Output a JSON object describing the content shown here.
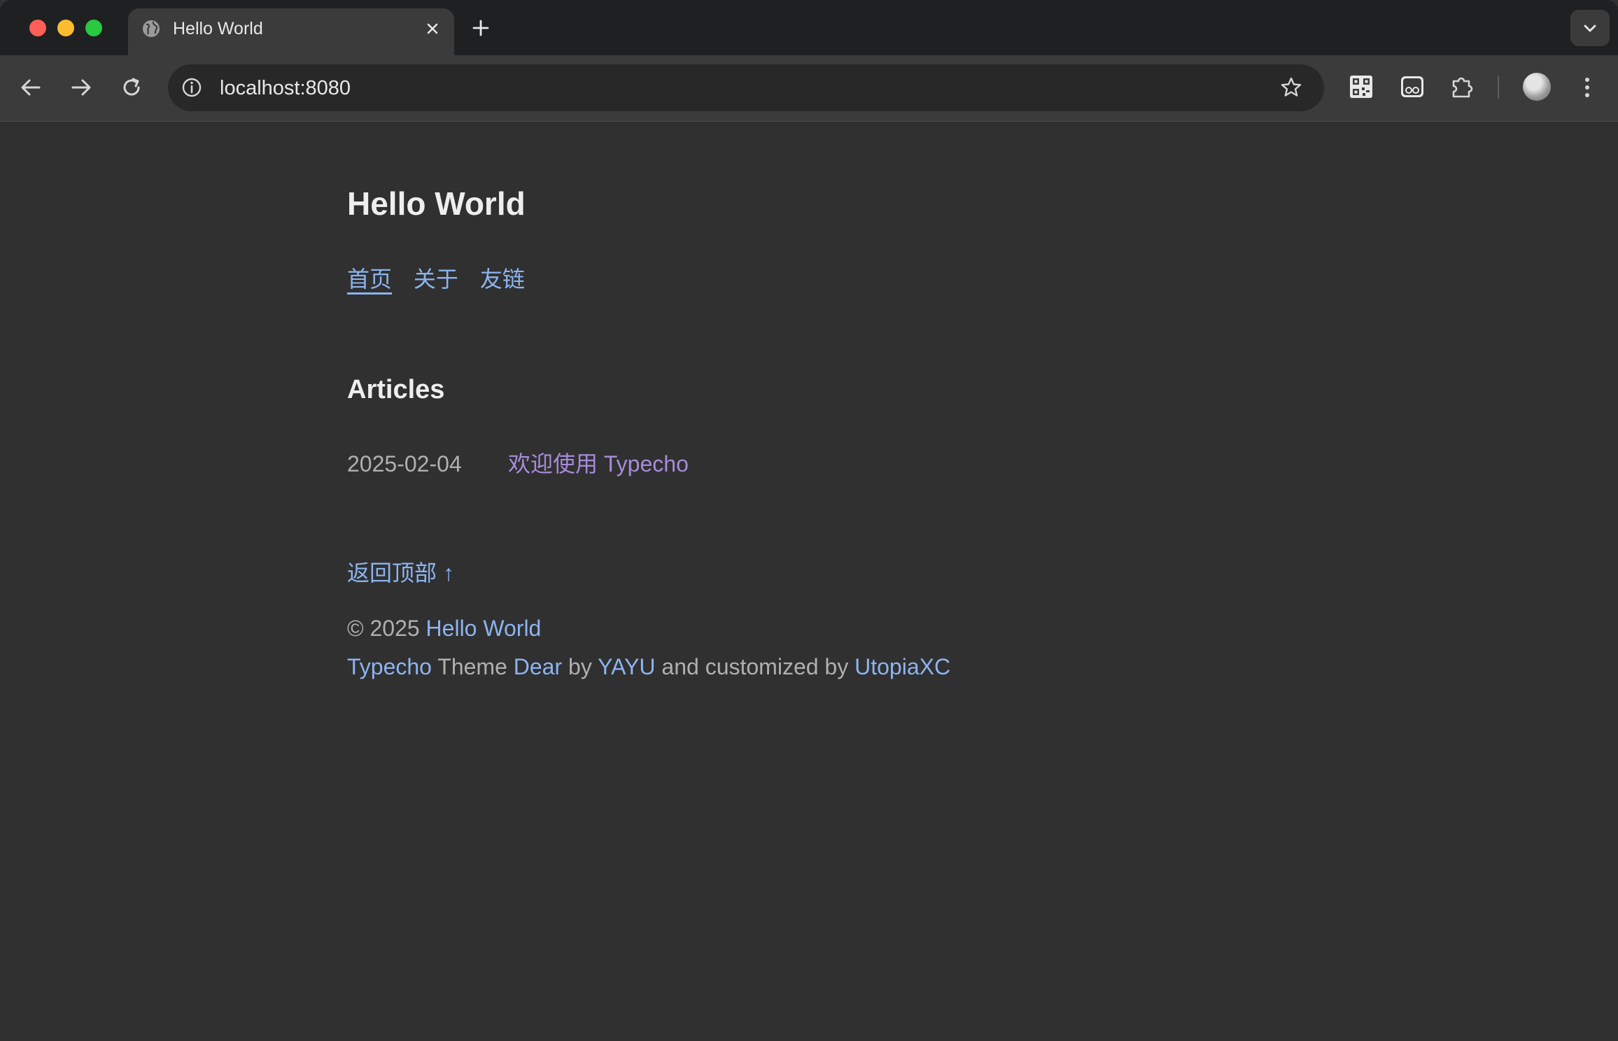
{
  "browser": {
    "tab": {
      "title": "Hello World",
      "favicon": "globe-icon"
    },
    "address_bar": {
      "url": "localhost:8080"
    },
    "icons": {
      "back": "back-arrow-icon",
      "forward": "forward-arrow-icon",
      "reload": "reload-icon",
      "site_info": "info-icon",
      "bookmark": "star-icon",
      "extension_1": "qr-code-icon",
      "extension_2": "reader-mode-icon",
      "extensions": "puzzle-icon",
      "menu": "more-vert-icon"
    }
  },
  "page": {
    "site_title": "Hello World",
    "nav": [
      {
        "label": "首页",
        "active": true
      },
      {
        "label": "关于",
        "active": false
      },
      {
        "label": "友链",
        "active": false
      }
    ],
    "section_title": "Articles",
    "articles": [
      {
        "date": "2025-02-04",
        "title": "欢迎使用 Typecho"
      }
    ],
    "back_to_top": "返回顶部 ↑",
    "footer": {
      "copyright_prefix": "© 2025 ",
      "site_link": "Hello World",
      "line2": {
        "typecho": "Typecho",
        "theme_text": " Theme ",
        "dear": "Dear",
        "by_text": " by ",
        "yayu": "YAYU",
        "customized_text": " and customized by ",
        "utopia": "UtopiaXC"
      }
    }
  },
  "colors": {
    "background": "#303030",
    "link": "#8cb4f0",
    "visited_link": "#a78bdb",
    "text_muted": "#b0b0b0",
    "heading": "#eeeeee"
  }
}
